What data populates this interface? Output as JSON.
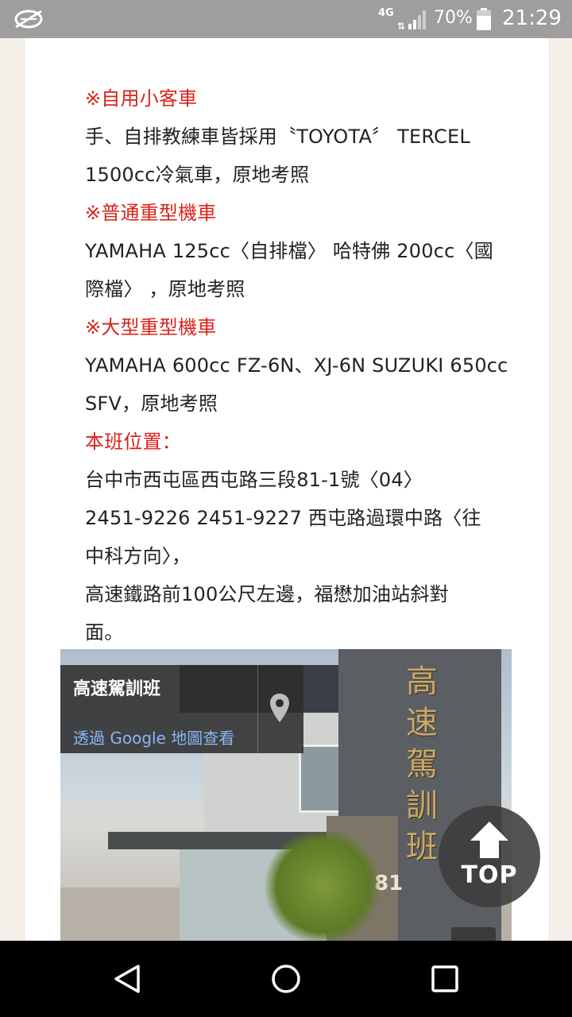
{
  "status_bar": {
    "network": "4G",
    "network_sub": "1",
    "battery_percent": "70%",
    "time": "21:29",
    "icons": [
      "no-sim-icon",
      "signal-icon",
      "battery-icon"
    ]
  },
  "content": {
    "lines": [
      {
        "text": "※自用小客車",
        "red": true
      },
      {
        "text": "手、自排教練車皆採用〝TOYOTA〞 TERCEL",
        "red": false
      },
      {
        "text": "1500cc冷氣車，原地考照",
        "red": false
      },
      {
        "text": "※普通重型機車",
        "red": true
      },
      {
        "text": "YAMAHA 125cc〈自排檔〉 哈特佛 200cc〈國",
        "red": false
      },
      {
        "text": "際檔〉 ，原地考照",
        "red": false
      },
      {
        "text": "※大型重型機車",
        "red": true
      },
      {
        "text": "YAMAHA 600cc FZ-6N、XJ-6N SUZUKI 650cc",
        "red": false
      },
      {
        "text": "SFV，原地考照",
        "red": false
      },
      {
        "text": "本班位置：",
        "red": true
      },
      {
        "text": "台中市西屯區西屯路三段81-1號〈04〉",
        "red": false
      },
      {
        "text": "2451-9226 2451-9227 西屯路過環中路〈往",
        "red": false
      },
      {
        "text": "中科方向〉，",
        "red": false
      },
      {
        "text": "高速鐵路前100公尺左邊，福懋加油站斜對",
        "red": false
      },
      {
        "text": "面。",
        "red": false
      }
    ]
  },
  "map": {
    "title": "高速駕訓班",
    "link_text": "透過 Google 地圖查看",
    "sign_chars": [
      "高",
      "速",
      "駕",
      "訓",
      "班"
    ],
    "house_number": "81",
    "pin_icon": "map-pin-icon"
  },
  "top_button": {
    "label": "TOP",
    "icon": "arrow-up-icon"
  },
  "nav_bar": {
    "icons": [
      "back-icon",
      "home-icon",
      "recents-icon"
    ]
  },
  "colors": {
    "accent_red": "#d9231b",
    "status_bar": "#9e9e9e",
    "link_blue": "#8ab4f8"
  }
}
